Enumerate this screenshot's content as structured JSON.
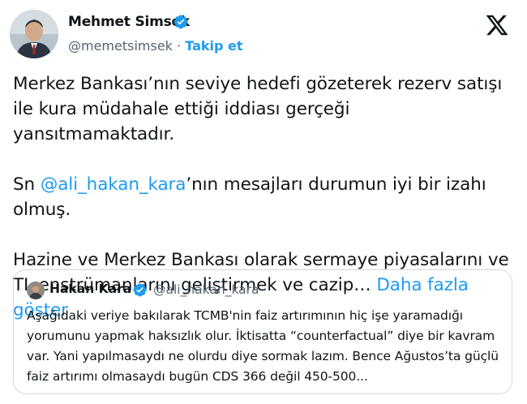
{
  "tweet": {
    "author": {
      "name": "Mehmet Simsek",
      "handle": "@memetsimsek",
      "separator": " · ",
      "follow_label": "Takip et",
      "avatar_icon": "profile-photo-icon"
    },
    "paragraphs": {
      "p1": "Merkez Bankası’nın seviye hedefi gözeterek rezerv satışı ile kura müdahale ettiği iddiası gerçeği yansıtmamaktadır.",
      "p2_prefix": "Sn ",
      "p2_mention": "@ali_hakan_kara",
      "p2_suffix": "’nın mesajları durumun iyi bir izahı olmuş.",
      "p3": "Hazine ve Merkez Bankası olarak sermaye piyasalarını ve TL enstrümanlarını geliştirmek ve cazip… ",
      "show_more": "Daha fazla göster"
    },
    "platform_icon": "x-logo-icon",
    "verified_color": "#1d9bf0",
    "link_color": "#1d9bf0"
  },
  "quote": {
    "name": "Hakan Kara",
    "handle": "@ali_hakan_kara",
    "text": "Aşağıdaki veriye bakılarak TCMB'nin faiz artırımının hiç işe yaramadığı yorumunu yapmak haksızlık olur. İktisatta “counterfactual” diye bir kavram var. Yani yapılmasaydı ne olurdu diye sormak lazım. Bence Ağustos’ta güçlü faiz artırımı olmasaydı bugün CDS 366 değil 450-500..."
  }
}
